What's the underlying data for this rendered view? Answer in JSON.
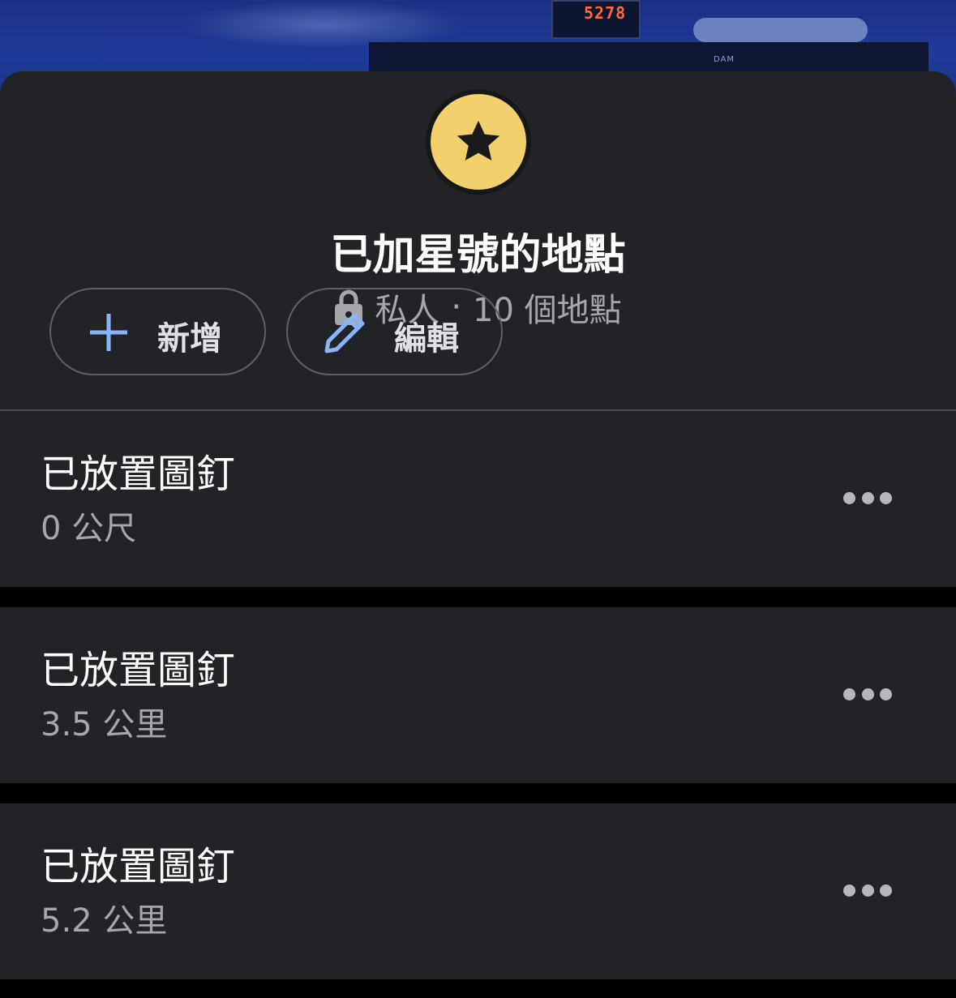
{
  "background": {
    "clock_text": "5278",
    "brand_text": "DAM"
  },
  "header": {
    "icon": "star-icon",
    "accent_color": "#f2d06b",
    "title": "已加星號的地點",
    "privacy_icon": "lock-icon",
    "privacy": "私人",
    "separator": "·",
    "count": "10 個地點"
  },
  "actions": {
    "add_label": "新增",
    "add_icon": "plus-icon",
    "edit_label": "編輯",
    "edit_icon": "pencil-icon",
    "icon_color": "#8ab4f8"
  },
  "places": [
    {
      "name": "已放置圖釘",
      "distance": "0 公尺"
    },
    {
      "name": "已放置圖釘",
      "distance": "3.5 公里"
    },
    {
      "name": "已放置圖釘",
      "distance": "5.2 公里"
    }
  ]
}
